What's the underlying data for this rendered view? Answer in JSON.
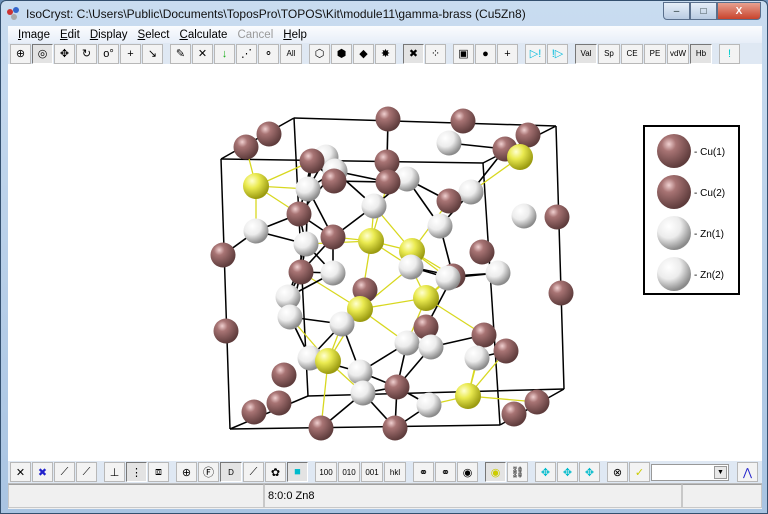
{
  "window": {
    "title": "IsoCryst: C:\\Users\\Public\\Documents\\ToposPro\\TOPOS\\Kit\\module11\\gamma-brass (Cu5Zn8)",
    "minimize": "–",
    "maximize": "□",
    "close": "X"
  },
  "menu": [
    {
      "label": "Image",
      "u": "I",
      "rest": "mage"
    },
    {
      "label": "Edit",
      "u": "E",
      "rest": "dit"
    },
    {
      "label": "Display",
      "u": "D",
      "rest": "isplay"
    },
    {
      "label": "Select",
      "u": "S",
      "rest": "elect"
    },
    {
      "label": "Calculate",
      "u": "C",
      "rest": "alculate"
    },
    {
      "label": "Cancel",
      "u": "",
      "rest": "Cancel",
      "disabled": true
    },
    {
      "label": "Help",
      "u": "H",
      "rest": "elp"
    }
  ],
  "toolbar_top": [
    {
      "icon": "crosshair-icon",
      "g": "⊕"
    },
    {
      "icon": "target-icon",
      "g": "◎",
      "pressed": true
    },
    {
      "icon": "rotate-xyz-icon",
      "g": "✥"
    },
    {
      "icon": "rotate-icon",
      "g": "↻"
    },
    {
      "icon": "rotate-angle-icon",
      "g": "o°"
    },
    {
      "icon": "move-icon",
      "g": "+"
    },
    {
      "icon": "pointer-icon",
      "g": "↘"
    },
    {
      "sep": true
    },
    {
      "icon": "pencil-icon",
      "g": "✎"
    },
    {
      "icon": "delete-icon",
      "g": "✕"
    },
    {
      "icon": "arrow-down-icon",
      "g": "↓"
    },
    {
      "icon": "hidden-bonds-icon",
      "g": "⋰"
    },
    {
      "icon": "atoms-icon",
      "g": "⚬"
    },
    {
      "icon": "select-all-icon",
      "g": "All",
      "txt": true
    },
    {
      "sep": true
    },
    {
      "icon": "polyhedron-icon",
      "g": "⬡"
    },
    {
      "icon": "polyhedron-grey-icon",
      "g": "⬢"
    },
    {
      "icon": "polyhedron-diamond-icon",
      "g": "◆"
    },
    {
      "icon": "polyhedron-burst-icon",
      "g": "✸"
    },
    {
      "sep": true
    },
    {
      "icon": "atom-cross-icon",
      "g": "✖",
      "pressed": true
    },
    {
      "icon": "atom-bonds-icon",
      "g": "⁘"
    },
    {
      "sep": true
    },
    {
      "icon": "frame-icon",
      "g": "▣"
    },
    {
      "icon": "spheres-icon",
      "g": "●"
    },
    {
      "icon": "axis-cross-icon",
      "g": "+"
    },
    {
      "sep": true
    },
    {
      "icon": "play-warning-icon",
      "g": "▷!"
    },
    {
      "icon": "warning-play-icon",
      "g": "!▷"
    },
    {
      "sep": true
    },
    {
      "label": "Val",
      "pressed": true
    },
    {
      "label": "Sp"
    },
    {
      "label": "CE"
    },
    {
      "label": "PE"
    },
    {
      "label": "vdW"
    },
    {
      "label": "Hb",
      "pressed": true
    },
    {
      "sep": true
    },
    {
      "icon": "light-bulb-icon",
      "g": "!"
    }
  ],
  "toolbar_bottom": [
    {
      "icon": "thin-cross-icon",
      "g": "✕"
    },
    {
      "icon": "blue-cross-icon",
      "g": "✖"
    },
    {
      "icon": "bond-thin-icon",
      "g": "⟋"
    },
    {
      "icon": "bond-thick-icon",
      "g": "⟋"
    },
    {
      "sep": true
    },
    {
      "icon": "axes-icon",
      "g": "⊥"
    },
    {
      "icon": "color-list-icon",
      "g": "⋮",
      "pressed": true
    },
    {
      "icon": "cube-icon",
      "g": "⧈"
    },
    {
      "sep": true
    },
    {
      "icon": "plus-circle-icon",
      "g": "⊕"
    },
    {
      "icon": "f-circle-icon",
      "g": "Ⓕ"
    },
    {
      "label": "D",
      "pressed": true
    },
    {
      "icon": "bond-link-icon",
      "g": "⟋"
    },
    {
      "icon": "cluster-icon",
      "g": "✿"
    },
    {
      "icon": "cyan-square-icon",
      "g": "■",
      "pressed": true
    },
    {
      "sep": true
    },
    {
      "label": "100"
    },
    {
      "label": "010"
    },
    {
      "label": "001"
    },
    {
      "label": "hkl"
    },
    {
      "sep": true
    },
    {
      "icon": "link-box-icon",
      "g": "⚭"
    },
    {
      "icon": "link-circle-icon",
      "g": "⚭"
    },
    {
      "icon": "grey-sphere-icon",
      "g": "◉"
    },
    {
      "sep": true
    },
    {
      "icon": "yellow-sphere-icon",
      "g": "◉",
      "pressed": true
    },
    {
      "icon": "chain-icon",
      "g": "⛓"
    },
    {
      "sep": true
    },
    {
      "icon": "move-cyan-icon",
      "g": "✥"
    },
    {
      "icon": "move-cyan2-icon",
      "g": "✥"
    },
    {
      "icon": "move-cyan3-icon",
      "g": "✥"
    },
    {
      "sep": true
    },
    {
      "icon": "cancel-circle-icon",
      "g": "⊗"
    },
    {
      "icon": "check-icon",
      "g": "✓"
    }
  ],
  "combo": {
    "value": ""
  },
  "curve_button": {
    "icon": "curve-icon",
    "g": "⋀"
  },
  "status": {
    "left": "",
    "coords": "8:0:0  Zn8",
    "right": ""
  },
  "legend": [
    {
      "label": "- Cu(1)",
      "color": "#9a6a6a"
    },
    {
      "label": "- Cu(2)",
      "color": "#9a6a6a"
    },
    {
      "label": "- Zn(1)",
      "color": "#e8e8e8"
    },
    {
      "label": "- Zn(2)",
      "color": "#e8e8e8"
    }
  ],
  "colors": {
    "cu": "#9a6a6a",
    "zn": "#eeeeee",
    "yellow": "#e8e84a",
    "bond": "#000000",
    "hbond": "#d8d820"
  }
}
